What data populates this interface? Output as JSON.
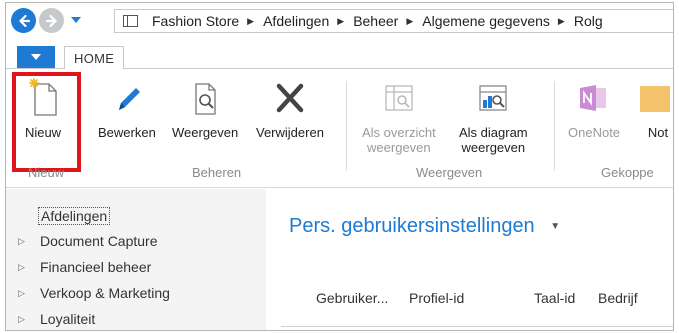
{
  "nav": {
    "back_icon": "arrow-left-icon",
    "forward_icon": "arrow-right-icon",
    "breadcrumb": [
      "Fashion Store",
      "Afdelingen",
      "Beheer",
      "Algemene gegevens",
      "Rolg"
    ]
  },
  "tabs": {
    "home": "HOME"
  },
  "ribbon": {
    "buttons": {
      "nieuw": "Nieuw",
      "bewerken": "Bewerken",
      "weergeven": "Weergeven",
      "verwijderen": "Verwijderen",
      "als_overzicht_1": "Als overzicht",
      "als_overzicht_2": "weergeven",
      "als_diagram_1": "Als diagram",
      "als_diagram_2": "weergeven",
      "onenote": "OneNote",
      "notes": "Not"
    },
    "groups": {
      "nieuw": "Nieuw",
      "beheren": "Beheren",
      "weergeven": "Weergeven",
      "gekoppeld": "Gekoppe"
    }
  },
  "navpane": {
    "items": [
      "Afdelingen",
      "Document Capture",
      "Financieel beheer",
      "Verkoop & Marketing",
      "Loyaliteit"
    ]
  },
  "main": {
    "title": "Pers. gebruikersinstellingen",
    "columns": [
      "Gebruiker...",
      "Profiel-id",
      "Taal-id",
      "Bedrijf"
    ]
  },
  "colors": {
    "accent": "#1e7ad3",
    "highlight": "#e0151b"
  }
}
